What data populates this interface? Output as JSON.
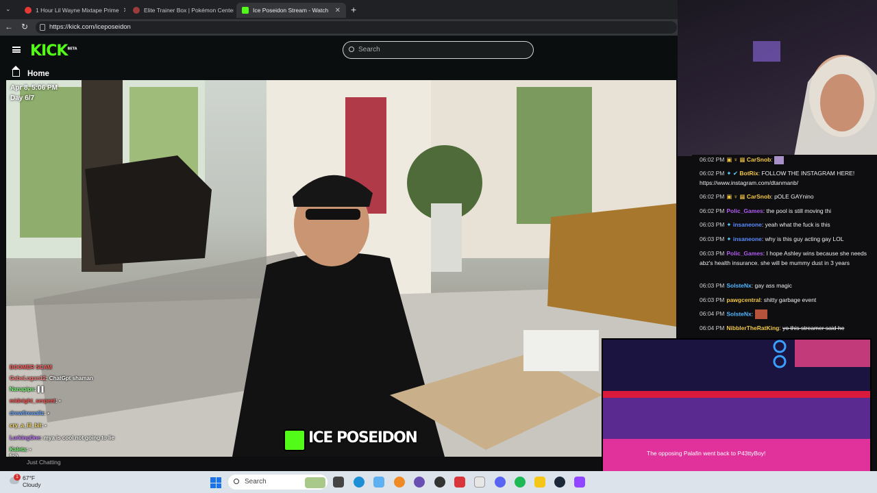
{
  "browser": {
    "tabs": [
      {
        "label": "1 Hour Lil Wayne Mixtape Prime",
        "active": false
      },
      {
        "label": "Elite Trainer Box | Pokémon Center",
        "active": false
      },
      {
        "label": "Ice Poseidon Stream - Watch",
        "active": true
      }
    ],
    "url": "https://kick.com/iceposeidon"
  },
  "kick": {
    "logo": "KICK",
    "logo_badge": "BETA",
    "search_placeholder": "Search",
    "home_label": "Home"
  },
  "stream": {
    "date": "Apr 8, 5:06 PM",
    "day": "Day 6/7",
    "title_overlay": "ICE POSEIDON",
    "category": "Just Chatting"
  },
  "overlay_chat": [
    {
      "user": "BOOMER SCAM",
      "text": ""
    },
    {
      "user": "GabeLogan12",
      "text": "ChatGpt shaman"
    },
    {
      "user": "Nanapips",
      "text": ""
    },
    {
      "user": "midnight_serpent",
      "text": ""
    },
    {
      "user": "drewfirewallz",
      "text": ""
    },
    {
      "user": "cry_a_lil_bit",
      "text": ""
    },
    {
      "user": "LurkingOne",
      "text": "mya is cool not going to lie"
    },
    {
      "user": "Kaleta",
      "text": ""
    },
    {
      "user": "fish",
      "text": ""
    }
  ],
  "chat": [
    {
      "time": "06:02 PM",
      "user": "CarSnob",
      "color": "#f2c744",
      "text": ""
    },
    {
      "time": "06:02 PM",
      "user": "BotRix",
      "color": "#f2c744",
      "text": "FOLLOW THE INSTAGRAM HERE! https://www.instagram.com/dtanmanb/"
    },
    {
      "time": "06:02 PM",
      "user": "CarSnob",
      "color": "#f2c744",
      "text": "pOLE GAYnino"
    },
    {
      "time": "06:02 PM",
      "user": "Polic_Games",
      "color": "#b05cf0",
      "text": "the pool is still moving thi"
    },
    {
      "time": "06:03 PM",
      "user": "insaneone",
      "color": "#5b8cff",
      "text": "yeah what the fuck is this"
    },
    {
      "time": "06:03 PM",
      "user": "insaneone",
      "color": "#5b8cff",
      "text": "why is this guy acting gay LOL"
    },
    {
      "time": "06:03 PM",
      "user": "Polic_Games",
      "color": "#b05cf0",
      "text": "I hope Ashley wins because she needs abz's health insurance. she will be mummy dust in 3 years"
    },
    {
      "time": "06:03 PM",
      "user": "SolsteNx",
      "color": "#4fb6ff",
      "text": "gay ass magic"
    },
    {
      "time": "06:03 PM",
      "user": "pawgcentral",
      "color": "#f2c744",
      "text": "shitty garbage event"
    },
    {
      "time": "06:04 PM",
      "user": "SolsteNx",
      "color": "#4fb6ff",
      "text": ""
    },
    {
      "time": "06:04 PM",
      "user": "NibblerTheRatKing",
      "color": "#f2c744",
      "text": "yo this streamer said he"
    }
  ],
  "game": {
    "message": "The opposing Palafin went back to P43ttyBoy!"
  },
  "taskbar": {
    "temp": "67°F",
    "condition": "Cloudy",
    "search": "Search",
    "weather_badge": "1"
  }
}
